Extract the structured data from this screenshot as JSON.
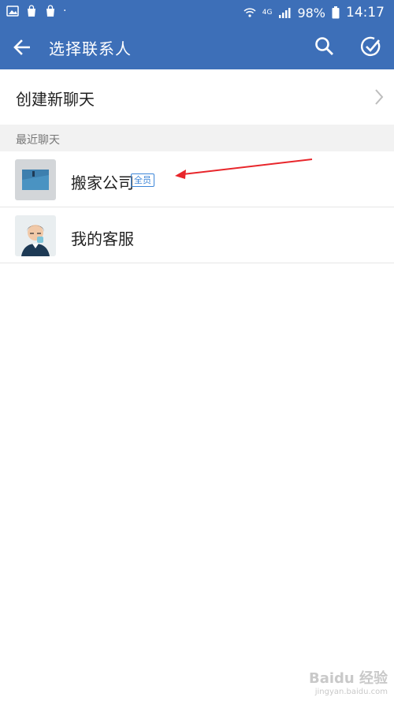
{
  "status_bar": {
    "battery": "98%",
    "time": "14:17",
    "network": "4G"
  },
  "app_bar": {
    "title": "选择联系人",
    "icons": [
      "back-arrow-icon",
      "search-icon",
      "multi-select-check-icon"
    ]
  },
  "create_chat": {
    "label": "创建新聊天"
  },
  "recent_section": {
    "label": "最近聊天",
    "items": [
      {
        "name": "搬家公司",
        "badge": "全员"
      },
      {
        "name": "我的客服",
        "badge": ""
      }
    ]
  },
  "watermark": {
    "text": "Baidu 经验",
    "sub": "jingyan.baidu.com"
  },
  "colors": {
    "app_bar": "#3d6fb8",
    "badge": "#3d86d8",
    "annotation_arrow": "#e8262b"
  }
}
